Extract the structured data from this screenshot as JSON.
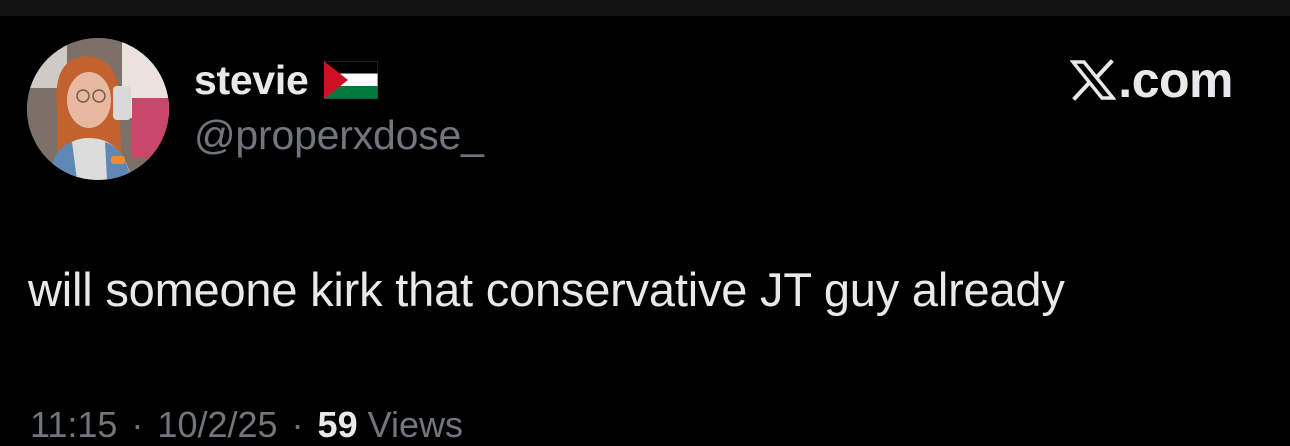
{
  "user": {
    "display_name": "stevie",
    "handle": "@properxdose_",
    "flag_icon": "palestine-flag-icon"
  },
  "brand": {
    "logo_icon": "x-logo-icon",
    "text": ".com"
  },
  "tweet": {
    "text": "will someone kirk that conservative JT guy already"
  },
  "meta": {
    "time": "11:15",
    "separator": "·",
    "date": "10/2/25",
    "views_count": "59",
    "views_label": "Views"
  },
  "colors": {
    "background": "#000000",
    "text_primary": "#e7e9ea",
    "text_secondary": "#71767b",
    "flag_red": "#ce1126",
    "flag_green": "#007a3d"
  }
}
